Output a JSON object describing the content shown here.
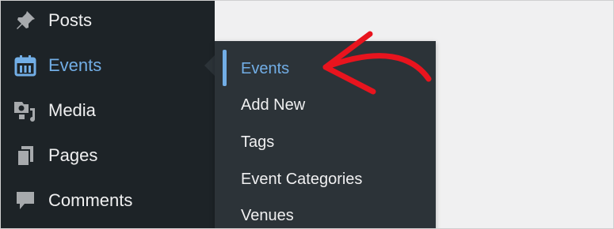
{
  "sidebar": {
    "items": [
      {
        "label": "Posts",
        "icon": "pin-icon"
      },
      {
        "label": "Events",
        "icon": "calendar-icon",
        "current": true
      },
      {
        "label": "Media",
        "icon": "media-icon"
      },
      {
        "label": "Pages",
        "icon": "pages-icon"
      },
      {
        "label": "Comments",
        "icon": "comment-icon"
      }
    ]
  },
  "submenu": {
    "items": [
      {
        "label": "Events",
        "current": true
      },
      {
        "label": "Add New"
      },
      {
        "label": "Tags"
      },
      {
        "label": "Event Categories"
      },
      {
        "label": "Venues"
      }
    ]
  },
  "colors": {
    "sidebar_bg": "#1d2327",
    "submenu_bg": "#2c3338",
    "accent": "#72aee6",
    "text": "#f0f0f1",
    "annotation_arrow": "#e8141e"
  }
}
